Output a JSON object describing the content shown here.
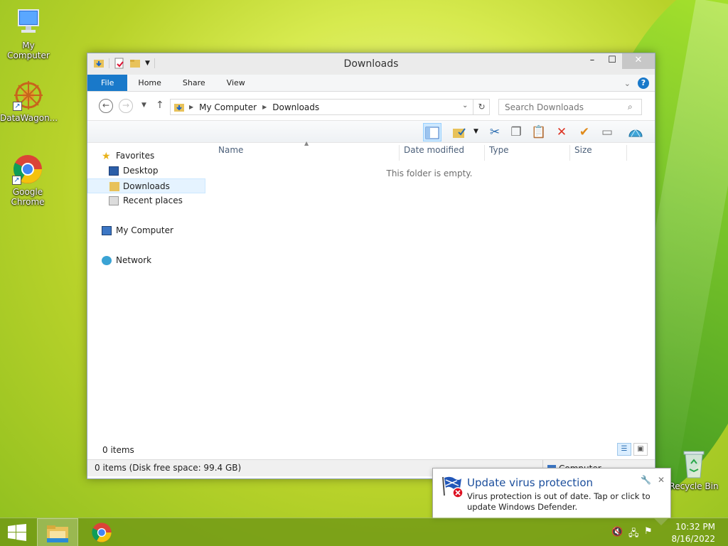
{
  "desktop": {
    "icons": [
      {
        "label": "My Computer"
      },
      {
        "label": "DataWagon..."
      },
      {
        "label": "Google Chrome"
      },
      {
        "label": "Recycle Bin"
      }
    ]
  },
  "window": {
    "title": "Downloads",
    "controls": {
      "minimize": "–",
      "maximize": "☐",
      "close": "✕"
    },
    "ribbon_tabs": [
      "File",
      "Home",
      "Share",
      "View"
    ],
    "address": {
      "crumbs": [
        "My Computer",
        "Downloads"
      ],
      "search_placeholder": "Search Downloads"
    },
    "nav": {
      "favorites": "Favorites",
      "desktop": "Desktop",
      "downloads": "Downloads",
      "recent": "Recent places",
      "computer": "My Computer",
      "network": "Network"
    },
    "columns": [
      "Name",
      "Date modified",
      "Type",
      "Size"
    ],
    "empty_message": "This folder is empty.",
    "status_items": "0 items",
    "status_bar_left": "0 items (Disk free space: 99.4 GB)",
    "status_bar_right": "Computer"
  },
  "toast": {
    "title": "Update virus protection",
    "body": "Virus protection is out of date. Tap or click to update Windows Defender."
  },
  "taskbar": {
    "time": "10:32 PM",
    "date": "8/16/2022"
  },
  "colors": {
    "accent": "#1979ca",
    "toast_title": "#1b4e9c"
  }
}
